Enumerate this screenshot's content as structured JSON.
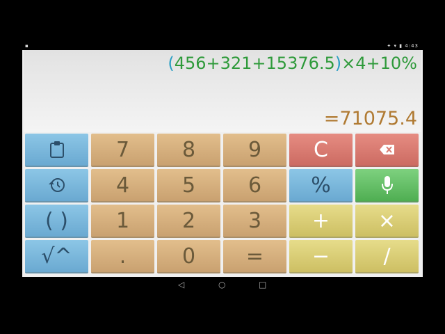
{
  "status": {
    "left": "▪",
    "right": "✦ ▾ ▮ 4:43"
  },
  "display": {
    "expr_open": "(",
    "expr_inner": "456+321+15376.5",
    "expr_close": ")",
    "expr_rest": "×4+10%",
    "result": "=71075.4"
  },
  "keys": {
    "clipboard": "",
    "seven": "7",
    "eight": "8",
    "nine": "9",
    "clear": "C",
    "backspace": "",
    "history": "",
    "four": "4",
    "five": "5",
    "six": "6",
    "percent": "%",
    "mic": "",
    "parens": "( )",
    "one": "1",
    "two": "2",
    "three": "3",
    "plus": "+",
    "times": "×",
    "sqrt_pow": "√^",
    "dot": ".",
    "zero": "0",
    "equals": "=",
    "minus": "−",
    "divide": "/"
  },
  "nav": {
    "back": "◁",
    "home": "○",
    "recents": "□"
  },
  "colors": {
    "blue": "#7bb8dc",
    "tan": "#d6b07e",
    "red": "#d97a70",
    "green": "#63c066",
    "yellow": "#d9cc74"
  }
}
